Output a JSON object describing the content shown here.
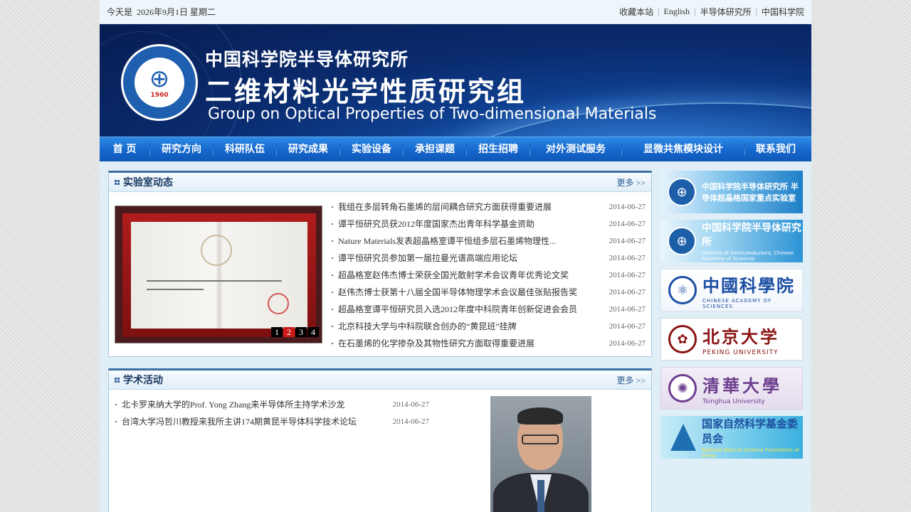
{
  "topbar": {
    "date_prefix": "今天是",
    "date": "2026年9月1日 星期二",
    "links": [
      "收藏本站",
      "English",
      "半导体研究所",
      "中国科学院"
    ]
  },
  "banner": {
    "logo_year": "1960",
    "title_cn": "中国科学院半导体研究所",
    "group_cn": "二维材料光学性质研究组",
    "group_en": "Group on Optical Properties of Two-dimensional Materials"
  },
  "nav": {
    "items": [
      "首 页",
      "研究方向",
      "科研队伍",
      "研究成果",
      "实验设备",
      "承担课题",
      "招生招聘",
      "对外测试服务",
      "显微共焦模块设计",
      "联系我们"
    ]
  },
  "news": {
    "title": "实验室动态",
    "more": "更多 >>",
    "pager": [
      "1",
      "2",
      "3",
      "4"
    ],
    "items": [
      {
        "title": "我组在多层转角石墨烯的层间耦合研究方面获得重要进展",
        "date": "2014-06-27"
      },
      {
        "title": "谭平恒研究员获2012年度国家杰出青年科学基金资助",
        "date": "2014-06-27"
      },
      {
        "title": "Nature Materials发表超晶格室谭平恒组多层石墨烯物理性...",
        "date": "2014-06-27"
      },
      {
        "title": "谭平恒研究员参加第一届拉曼光谱高端应用论坛",
        "date": "2014-06-27"
      },
      {
        "title": "超晶格室赵伟杰博士荣获全国光散射学术会议青年优秀论文奖",
        "date": "2014-06-27"
      },
      {
        "title": "赵伟杰博士获第十八届全国半导体物理学术会议最佳张贴报告奖",
        "date": "2014-06-27"
      },
      {
        "title": "超晶格室谭平恒研究员入选2012年度中科院青年创新促进会会员",
        "date": "2014-06-27"
      },
      {
        "title": "北京科技大学与中科院联合创办的“黄昆班”挂牌",
        "date": "2014-06-27"
      },
      {
        "title": "在石墨烯的化学掺杂及其物性研究方面取得重要进展",
        "date": "2014-06-27"
      }
    ]
  },
  "academic": {
    "title": "学术活动",
    "more": "更多 >>",
    "items": [
      {
        "title": "北卡罗来纳大学的Prof. Yong Zhang来半导体所主持学术沙龙",
        "date": "2014-06-27"
      },
      {
        "title": "台湾大学冯哲川教授来我所主讲174期黄昆半导体科学技术论坛",
        "date": "2014-06-27"
      }
    ]
  },
  "sidebar_logos": [
    {
      "zh": "中国科学院半导体研究所 半导体超晶格国家重点实验室",
      "en": ""
    },
    {
      "zh": "中国科学院半导体研究所",
      "en": "Institute of Semiconductors, Chinese Academy of Sciences"
    },
    {
      "zh": "中國科學院",
      "en": "CHINESE ACADEMY OF SCIENCES"
    },
    {
      "zh": "北京大学",
      "en": "PEKING UNIVERSITY"
    },
    {
      "zh": "清華大學",
      "en": "Tsinghua University"
    },
    {
      "zh": "国家自然科学基金委员会",
      "en": "National Natural Science Foundation of China"
    }
  ],
  "colors": {
    "nav": "#1567cc",
    "banner": "#0a2b6e",
    "panel_border": "#3b6ea2",
    "pager_active": "#cc1b1b"
  }
}
